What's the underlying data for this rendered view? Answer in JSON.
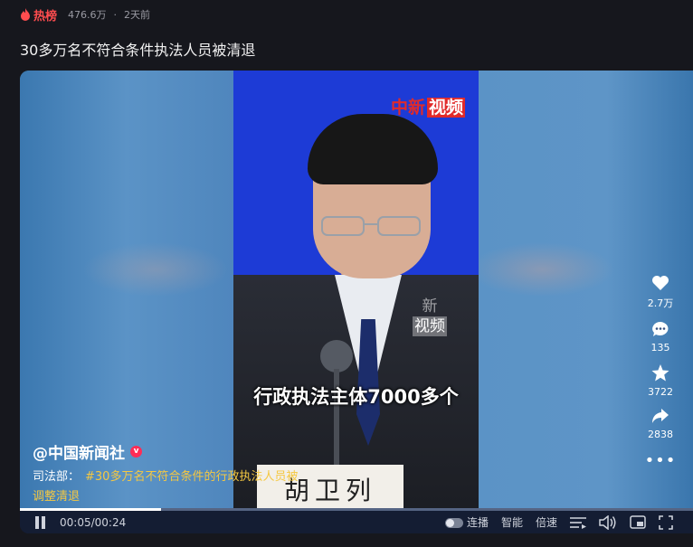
{
  "header": {
    "hot_label": "热榜",
    "views": "476.6万",
    "separator": "·",
    "time_ago": "2天前"
  },
  "title": "30多万名不符合条件执法人员被清退",
  "video": {
    "logo": "中新",
    "logo_box": "视频",
    "watermark_line1": "新",
    "watermark_line2": "视频",
    "nameplate": "胡卫列",
    "subtitle": "行政执法主体7000多个"
  },
  "author": "@中国新闻社",
  "verified_badge": "v",
  "description": {
    "prefix": "司法部：",
    "hashtag": "#30多万名不符合条件的行政执法人员被"
  },
  "quality_text": "调整清退",
  "actions": [
    {
      "icon": "heart-icon",
      "count": "2.7万"
    },
    {
      "icon": "comment-icon",
      "count": "135"
    },
    {
      "icon": "star-icon",
      "count": "3722"
    },
    {
      "icon": "share-icon",
      "count": "2838"
    }
  ],
  "more_glyph": "•••",
  "player": {
    "current_time": "00:05",
    "time_sep": "/",
    "duration": "00:24",
    "progress_fraction": 0.21,
    "autoplay_label": "连播",
    "smart_label": "智能",
    "speed_label": "倍速"
  },
  "colors": {
    "accent_hot": "#ff4d4f",
    "hashtag": "#f5c842",
    "video_bg": "#1d3bd6",
    "badge": "#ff2c55"
  }
}
